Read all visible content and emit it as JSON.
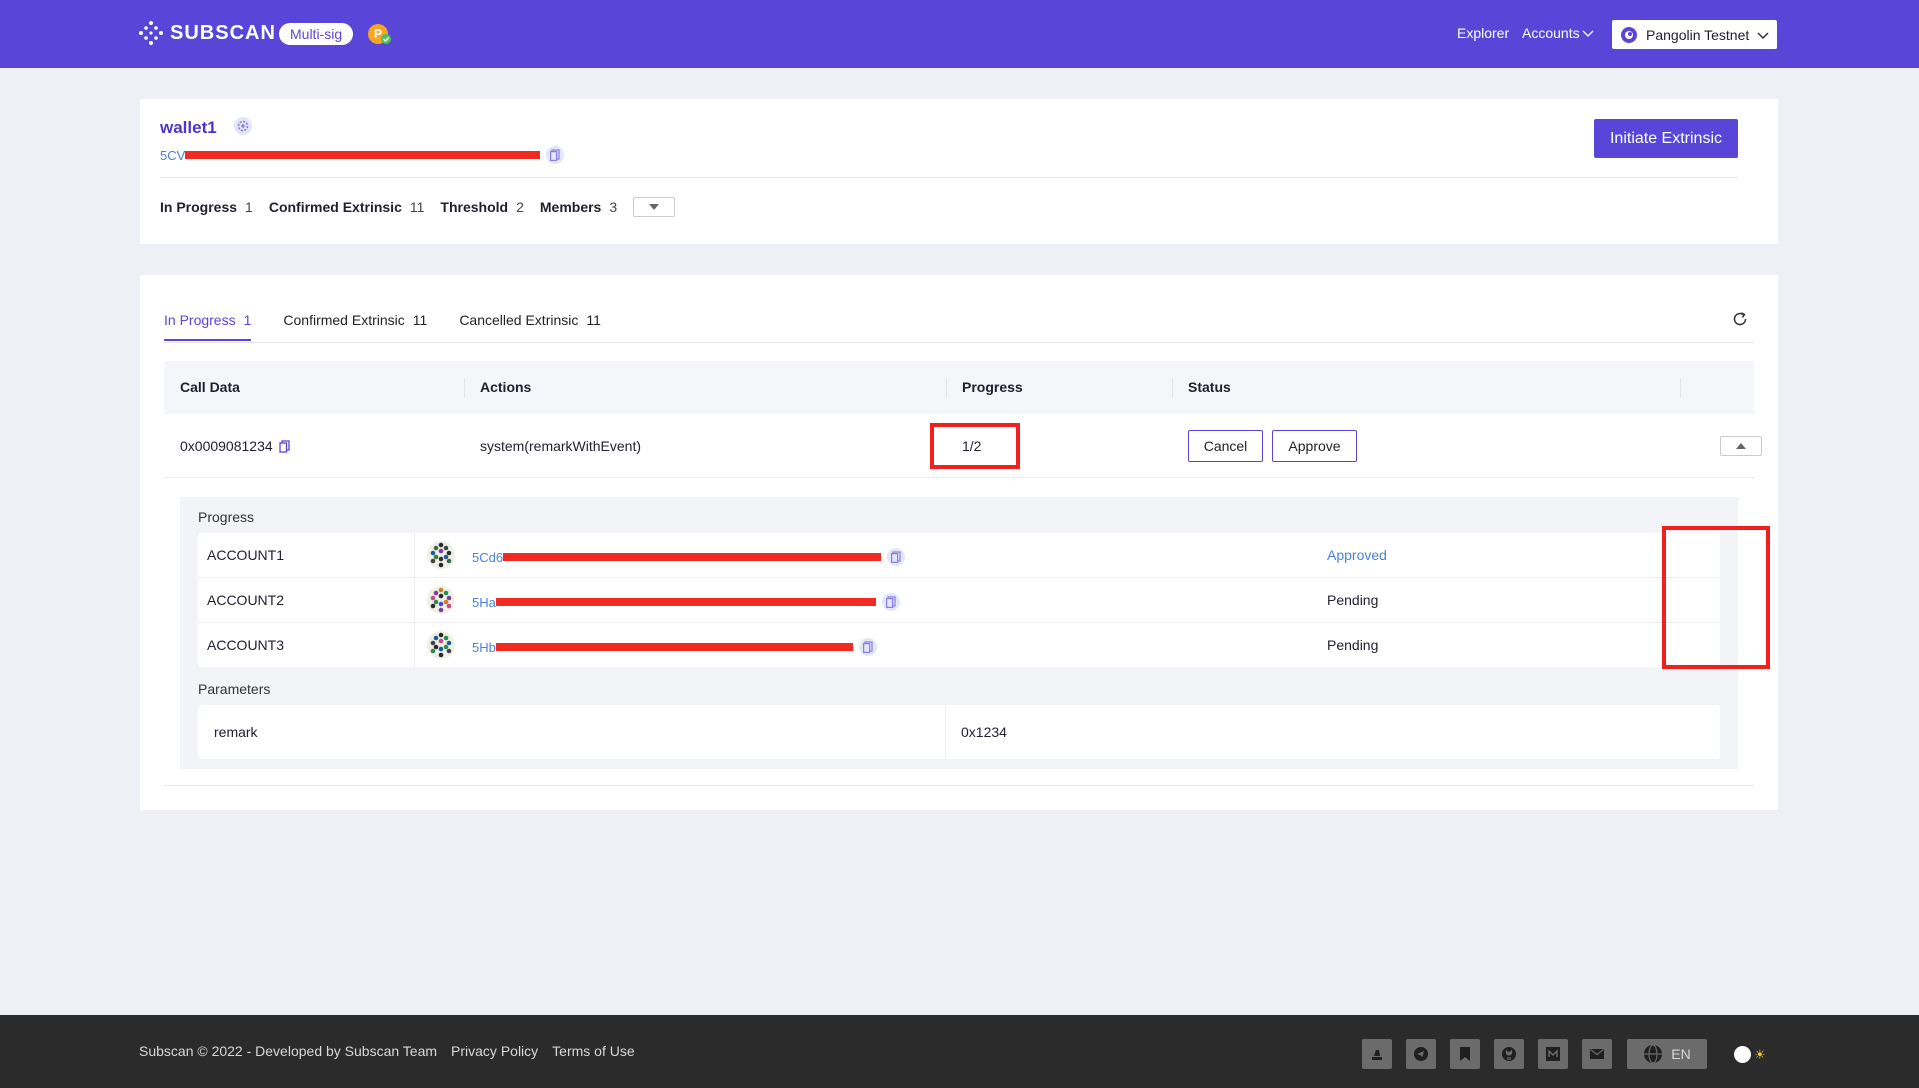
{
  "header": {
    "logo_text": "SUBSCAN",
    "badge": "Multi-sig",
    "nav": {
      "explorer": "Explorer",
      "accounts": "Accounts"
    },
    "network": "Pangolin Testnet"
  },
  "wallet": {
    "name": "wallet1",
    "address_prefix": "5CV",
    "initiate_button": "Initiate Extrinsic",
    "stats": [
      {
        "label": "In Progress",
        "value": "1"
      },
      {
        "label": "Confirmed Extrinsic",
        "value": "11"
      },
      {
        "label": "Threshold",
        "value": "2"
      },
      {
        "label": "Members",
        "value": "3"
      }
    ]
  },
  "tabs": [
    {
      "label": "In Progress",
      "count": "1"
    },
    {
      "label": "Confirmed Extrinsic",
      "count": "11"
    },
    {
      "label": "Cancelled Extrinsic",
      "count": "11"
    }
  ],
  "table": {
    "headers": {
      "call_data": "Call Data",
      "actions": "Actions",
      "progress": "Progress",
      "status": "Status"
    },
    "row": {
      "call_data": "0x0009081234",
      "action": "system(remarkWithEvent)",
      "progress": "1/2",
      "progress_fraction": 0.5,
      "cancel": "Cancel",
      "approve": "Approve"
    }
  },
  "detail": {
    "progress_label": "Progress",
    "accounts": [
      {
        "name": "ACCOUNT1",
        "address_prefix": "5Cd6",
        "status": "Approved"
      },
      {
        "name": "ACCOUNT2",
        "address_prefix": "5Ha",
        "status": "Pending"
      },
      {
        "name": "ACCOUNT3",
        "address_prefix": "5Hb",
        "status": "Pending"
      }
    ],
    "parameters_label": "Parameters",
    "parameter": {
      "key": "remark",
      "value": "0x1234"
    }
  },
  "footer": {
    "copyright": "Subscan © 2022 - Developed by Subscan Team",
    "privacy": "Privacy Policy",
    "terms": "Terms of Use",
    "language": "EN"
  },
  "colors": {
    "brand": "#5a45d9",
    "link": "#4a82d8",
    "highlight": "#f21f1f"
  }
}
